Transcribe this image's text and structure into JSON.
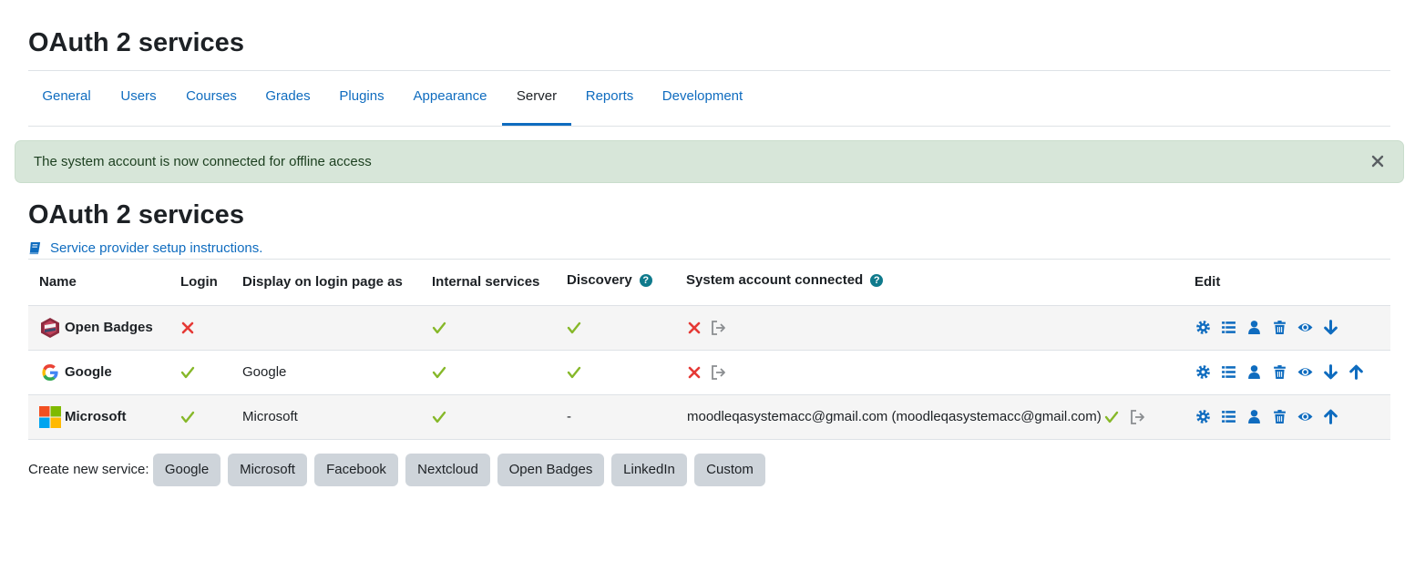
{
  "page": {
    "title": "OAuth 2 services"
  },
  "tabs": [
    {
      "label": "General"
    },
    {
      "label": "Users"
    },
    {
      "label": "Courses"
    },
    {
      "label": "Grades"
    },
    {
      "label": "Plugins"
    },
    {
      "label": "Appearance"
    },
    {
      "label": "Server",
      "active": true
    },
    {
      "label": "Reports"
    },
    {
      "label": "Development"
    }
  ],
  "alert": {
    "message": "The system account is now connected for offline access",
    "close_icon": "close-icon"
  },
  "section": {
    "title": "OAuth 2 services",
    "setup_link": "Service provider setup instructions.",
    "setup_icon": "book-icon"
  },
  "table": {
    "headers": {
      "name": "Name",
      "login": "Login",
      "display": "Display on login page as",
      "internal": "Internal services",
      "discovery": "Discovery",
      "system_account": "System account connected",
      "edit": "Edit"
    },
    "rows": [
      {
        "name": "Open Badges",
        "icon": "open-badges-logo",
        "login": "no",
        "display": "",
        "internal": "yes",
        "discovery": "yes",
        "system_account": "",
        "system_account_status": "no",
        "edit_icons": [
          "gear-icon",
          "list-icon",
          "user-icon",
          "trash-icon",
          "eye-icon",
          "arrow-down-icon"
        ]
      },
      {
        "name": "Google",
        "icon": "google-logo",
        "login": "yes",
        "display": "Google",
        "internal": "yes",
        "discovery": "yes",
        "system_account": "",
        "system_account_status": "no",
        "edit_icons": [
          "gear-icon",
          "list-icon",
          "user-icon",
          "trash-icon",
          "eye-icon",
          "arrow-down-icon",
          "arrow-up-icon"
        ]
      },
      {
        "name": "Microsoft",
        "icon": "microsoft-logo",
        "login": "yes",
        "display": "Microsoft",
        "internal": "yes",
        "discovery": "-",
        "system_account": "moodleqasystemacc@gmail.com (moodleqasystemacc@gmail.com)",
        "system_account_status": "yes",
        "edit_icons": [
          "gear-icon",
          "list-icon",
          "user-icon",
          "trash-icon",
          "eye-icon",
          "arrow-up-icon"
        ]
      }
    ]
  },
  "create": {
    "label": "Create new service:",
    "buttons": [
      "Google",
      "Microsoft",
      "Facebook",
      "Nextcloud",
      "Open Badges",
      "LinkedIn",
      "Custom"
    ]
  },
  "colors": {
    "link": "#0f6cbf",
    "check": "#86b829",
    "cross": "#e53935",
    "alert_bg": "#d7e6d9",
    "button_bg": "#ced4da"
  }
}
